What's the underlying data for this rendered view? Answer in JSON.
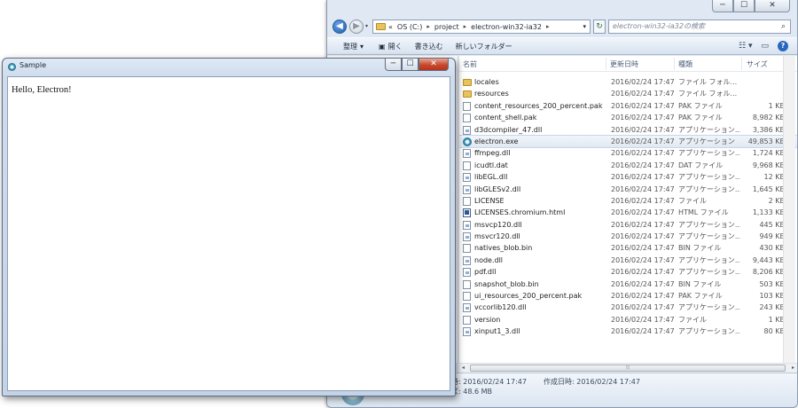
{
  "explorer": {
    "window_buttons": {
      "minimize": "─",
      "maximize": "☐",
      "close": "✕"
    },
    "nav": {
      "back_glyph": "◀",
      "forward_glyph": "▶",
      "history_glyph": "▾"
    },
    "address": {
      "prefix": "«",
      "segments": [
        "OS (C:)",
        "project",
        "electron-win32-ia32"
      ],
      "separator": "▸",
      "dropdown_glyph": "▾"
    },
    "refresh_glyph": "↻",
    "search": {
      "placeholder": "electron-win32-ia32の検索",
      "icon": "magnifier-icon",
      "icon_glyph": "⌕"
    },
    "command_bar": {
      "organize": "整理",
      "organize_caret": "▾",
      "open": "開く",
      "burn": "書き込む",
      "new_folder": "新しいフォルダー",
      "view_glyph": "☷",
      "view_caret": "▾",
      "preview_glyph": "▭",
      "help_glyph": "?"
    },
    "columns": {
      "name": "名前",
      "date": "更新日時",
      "type": "種類",
      "size": "サイズ",
      "sort_glyph": "^"
    },
    "files": [
      {
        "name": "locales",
        "date": "2016/02/24 17:47",
        "type": "ファイル フォル...",
        "size": "",
        "kind": "folder"
      },
      {
        "name": "resources",
        "date": "2016/02/24 17:47",
        "type": "ファイル フォル...",
        "size": "",
        "kind": "folder"
      },
      {
        "name": "content_resources_200_percent.pak",
        "date": "2016/02/24 17:47",
        "type": "PAK ファイル",
        "size": "1 KB",
        "kind": "file"
      },
      {
        "name": "content_shell.pak",
        "date": "2016/02/24 17:47",
        "type": "PAK ファイル",
        "size": "8,982 KB",
        "kind": "file"
      },
      {
        "name": "d3dcompiler_47.dll",
        "date": "2016/02/24 17:47",
        "type": "アプリケーション...",
        "size": "3,386 KB",
        "kind": "dll"
      },
      {
        "name": "electron.exe",
        "date": "2016/02/24 17:47",
        "type": "アプリケーション",
        "size": "49,853 KB",
        "kind": "exe"
      },
      {
        "name": "ffmpeg.dll",
        "date": "2016/02/24 17:47",
        "type": "アプリケーション...",
        "size": "1,724 KB",
        "kind": "dll"
      },
      {
        "name": "icudtl.dat",
        "date": "2016/02/24 17:47",
        "type": "DAT ファイル",
        "size": "9,968 KB",
        "kind": "file"
      },
      {
        "name": "libEGL.dll",
        "date": "2016/02/24 17:47",
        "type": "アプリケーション...",
        "size": "12 KB",
        "kind": "dll"
      },
      {
        "name": "libGLESv2.dll",
        "date": "2016/02/24 17:47",
        "type": "アプリケーション...",
        "size": "1,645 KB",
        "kind": "dll"
      },
      {
        "name": "LICENSE",
        "date": "2016/02/24 17:47",
        "type": "ファイル",
        "size": "2 KB",
        "kind": "file"
      },
      {
        "name": "LICENSES.chromium.html",
        "date": "2016/02/24 17:47",
        "type": "HTML ファイル",
        "size": "1,133 KB",
        "kind": "html"
      },
      {
        "name": "msvcp120.dll",
        "date": "2016/02/24 17:47",
        "type": "アプリケーション...",
        "size": "445 KB",
        "kind": "dll"
      },
      {
        "name": "msvcr120.dll",
        "date": "2016/02/24 17:47",
        "type": "アプリケーション...",
        "size": "949 KB",
        "kind": "dll"
      },
      {
        "name": "natives_blob.bin",
        "date": "2016/02/24 17:47",
        "type": "BIN ファイル",
        "size": "430 KB",
        "kind": "file"
      },
      {
        "name": "node.dll",
        "date": "2016/02/24 17:47",
        "type": "アプリケーション...",
        "size": "9,443 KB",
        "kind": "dll"
      },
      {
        "name": "pdf.dll",
        "date": "2016/02/24 17:47",
        "type": "アプリケーション...",
        "size": "8,206 KB",
        "kind": "dll"
      },
      {
        "name": "snapshot_blob.bin",
        "date": "2016/02/24 17:47",
        "type": "BIN ファイル",
        "size": "503 KB",
        "kind": "file"
      },
      {
        "name": "ui_resources_200_percent.pak",
        "date": "2016/02/24 17:47",
        "type": "PAK ファイル",
        "size": "103 KB",
        "kind": "file"
      },
      {
        "name": "vccorlib120.dll",
        "date": "2016/02/24 17:47",
        "type": "アプリケーション...",
        "size": "243 KB",
        "kind": "dll"
      },
      {
        "name": "version",
        "date": "2016/02/24 17:47",
        "type": "ファイル",
        "size": "1 KB",
        "kind": "file"
      },
      {
        "name": "xinput1_3.dll",
        "date": "2016/02/24 17:47",
        "type": "アプリケーション...",
        "size": "80 KB",
        "kind": "dll"
      }
    ],
    "selected_file": "electron.exe",
    "scrollbar": {
      "left_glyph": "◂",
      "right_glyph": "▸",
      "grip": "⦙⦙⦙"
    },
    "details": {
      "modified_partial": "時: 2016/02/24 17:47",
      "created": "作成日時: 2016/02/24 17:47",
      "size_partial": "ズ: 48.6 MB"
    }
  },
  "sample_window": {
    "title": "Sample",
    "icon": "electron-app-icon",
    "body_text": "Hello, Electron!",
    "window_buttons": {
      "minimize": "─",
      "maximize": "☐",
      "close": "✕"
    }
  },
  "colors": {
    "accent": "#1b5aa8",
    "close_button": "#c74a2f",
    "folder": "#e8c35a",
    "selection": "#e2e9f3"
  }
}
